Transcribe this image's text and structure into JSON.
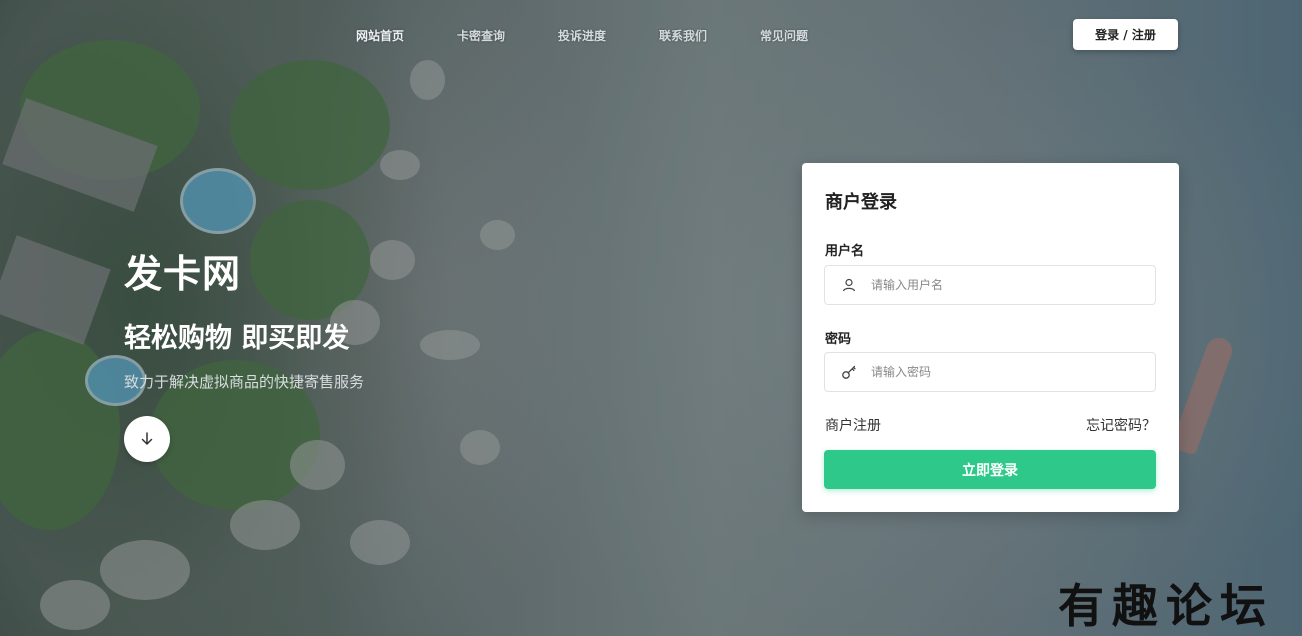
{
  "nav": {
    "items": [
      "网站首页",
      "卡密查询",
      "投诉进度",
      "联系我们",
      "常见问题"
    ],
    "login_label": "登录 / 注册"
  },
  "hero": {
    "title": "发卡网",
    "subtitle": "轻松购物 即买即发",
    "description": "致力于解决虚拟商品的快捷寄售服务",
    "scroll_icon": "arrow-down-icon"
  },
  "login_card": {
    "title": "商户登录",
    "username_label": "用户名",
    "username_placeholder": "请输入用户名",
    "username_icon": "user-icon",
    "password_label": "密码",
    "password_placeholder": "请输入密码",
    "password_icon": "key-icon",
    "register_link": "商户注册",
    "forgot_link": "忘记密码？",
    "submit_label": "立即登录"
  },
  "watermark": "有趣论坛",
  "colors": {
    "accent": "#2ec98a",
    "card_bg": "#ffffff"
  }
}
